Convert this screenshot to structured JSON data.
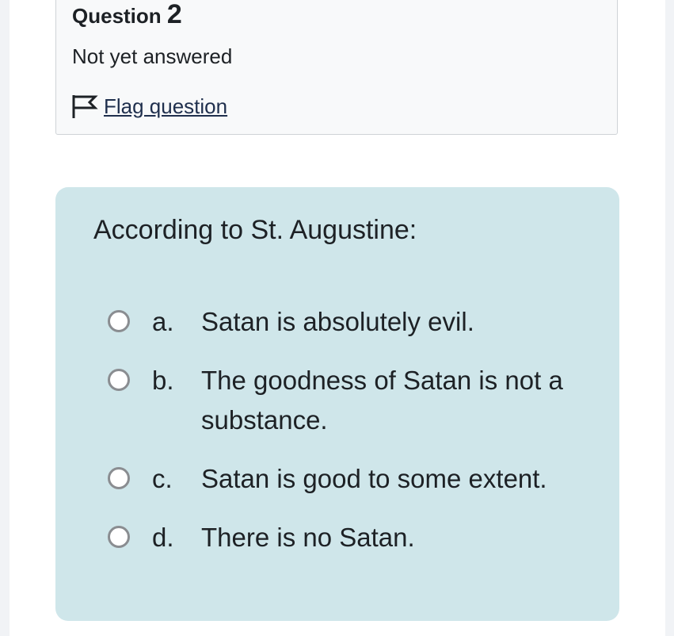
{
  "info": {
    "question_label": "Question",
    "question_number": "2",
    "state": "Not yet answered",
    "flag_label": "Flag question"
  },
  "question": {
    "text": "According to St. Augustine:",
    "answers": [
      {
        "letter": "a.",
        "text": "Satan is absolutely evil."
      },
      {
        "letter": "b.",
        "text": "The goodness of Satan is not a substance."
      },
      {
        "letter": "c.",
        "text": "Satan is good to some extent."
      },
      {
        "letter": "d.",
        "text": "There is no Satan."
      }
    ]
  },
  "colors": {
    "content_bg": "#cfe6ea",
    "info_bg": "#f8f9fa",
    "link": "#1f2f4d"
  }
}
